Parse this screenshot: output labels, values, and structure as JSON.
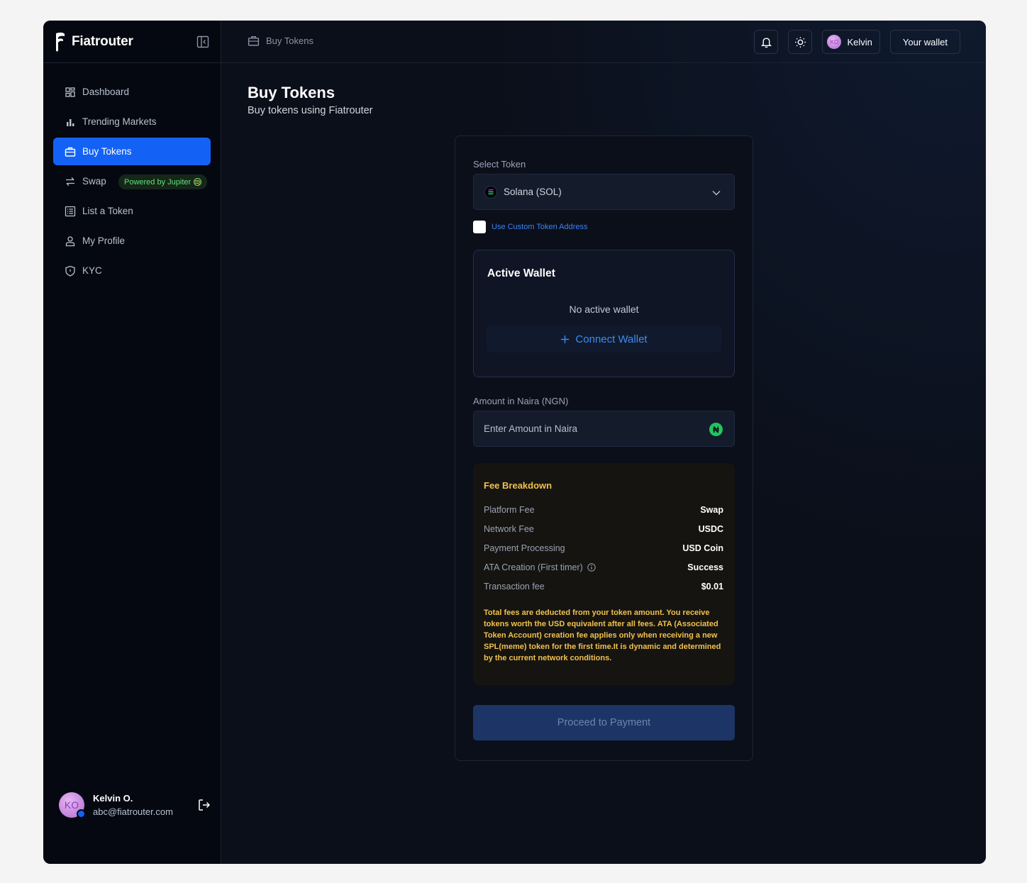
{
  "brand": {
    "name": "Fiatrouter"
  },
  "sidebar": {
    "items": [
      {
        "label": "Dashboard",
        "icon": "grid-icon"
      },
      {
        "label": "Trending Markets",
        "icon": "bar-chart-icon"
      },
      {
        "label": "Buy Tokens",
        "icon": "briefcase-icon",
        "active": true
      },
      {
        "label": "Swap",
        "icon": "swap-arrows-icon",
        "badge": "Powered by Jupiter"
      },
      {
        "label": "List a Token",
        "icon": "list-icon"
      },
      {
        "label": "My Profile",
        "icon": "user-icon"
      },
      {
        "label": "KYC",
        "icon": "shield-icon"
      }
    ],
    "user": {
      "name": "Kelvin O.",
      "email": "abc@fiatrouter.com",
      "initials": "KO"
    }
  },
  "topbar": {
    "breadcrumb": "Buy Tokens",
    "user_pill": {
      "name": "Kelvin",
      "initials": "KO"
    },
    "wallet_label": "Your wallet"
  },
  "page": {
    "title": "Buy Tokens",
    "subtitle": "Buy tokens using Fiatrouter"
  },
  "form": {
    "select_token_label": "Select Token",
    "selected_token": "Solana (SOL)",
    "custom_address_label": "Use Custom Token Address",
    "active_wallet_title": "Active Wallet",
    "no_wallet_text": "No active wallet",
    "connect_wallet_label": "Connect Wallet",
    "amount_label": "Amount in Naira (NGN)",
    "amount_placeholder": "Enter Amount in Naira",
    "currency_symbol": "₦",
    "fee": {
      "title": "Fee Breakdown",
      "rows": [
        {
          "label": "Platform Fee",
          "value": "Swap"
        },
        {
          "label": "Network Fee",
          "value": "USDC"
        },
        {
          "label": "Payment Processing",
          "value": "USD Coin"
        },
        {
          "label": "ATA Creation (First timer)",
          "value": "Success"
        },
        {
          "label": "Transaction fee",
          "value": "$0.01"
        }
      ],
      "note": "Total fees are deducted from your token amount. You receive tokens worth the USD equivalent after all fees. ATA (Associated Token Account) creation fee applies only when receiving a new SPL(meme) token for the first time.It is dynamic and determined by the current network conditions."
    },
    "proceed_label": "Proceed to Payment"
  },
  "colors": {
    "accent": "#1462f5",
    "fee_text": "#f2c14e",
    "badge_text": "#5ee37a",
    "link": "#3b82f6"
  }
}
